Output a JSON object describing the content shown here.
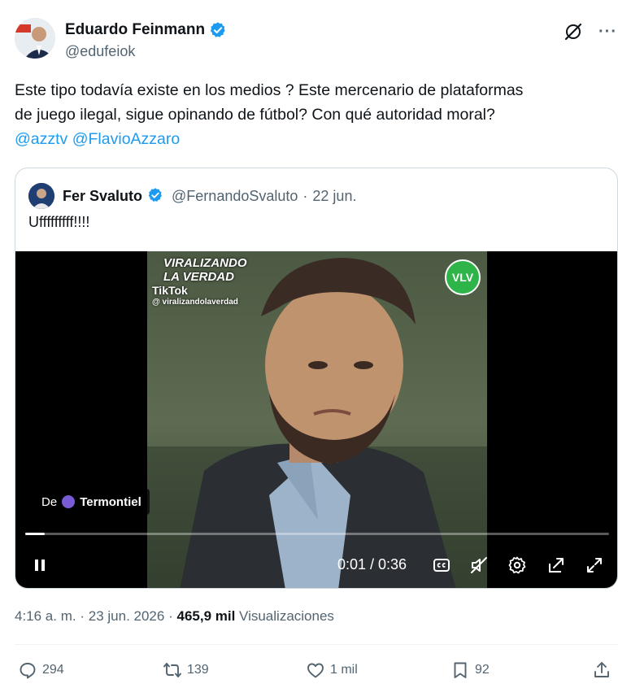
{
  "author": {
    "name": "Eduardo Feinmann",
    "handle": "@edufeiok",
    "verified_color": "#1d9bf0"
  },
  "tweet": {
    "lines": [
      "Este tipo todavía existe en los medios ?  Este mercenario de plataformas",
      "de juego ilegal, sigue opinando de fútbol?  Con qué autoridad moral?"
    ],
    "mentions": "@azztv @FlavioAzzaro"
  },
  "quote": {
    "name": "Fer Svaluto",
    "handle": "@FernandoSvaluto",
    "separator": "·",
    "date": "22 jun.",
    "text": "Ufffffffff!!!!"
  },
  "video": {
    "watermark_brand_line1": "VIRALIZANDO",
    "watermark_brand_line2": "LA VERDAD",
    "watermark_platform": "TikTok",
    "watermark_user": "@ viralizandolaverdad",
    "logo_text": "VLV",
    "source_prefix": "De",
    "source_name": "Termontiel",
    "progress_fraction": 0.034,
    "time": "0:01 / 0:36"
  },
  "meta": {
    "time": "4:16 a. m.",
    "separator": "·",
    "date": "23 jun. 2026",
    "views_count": "465,9 mil",
    "views_label": "Visualizaciones"
  },
  "actions": {
    "replies": "294",
    "reposts": "139",
    "likes": "1 mil",
    "bookmarks": "92"
  },
  "colors": {
    "accent": "#1d9bf0",
    "text": "#0f1419",
    "secondary": "#536471"
  },
  "icons": {
    "verified": "verified-badge-icon",
    "grok": "grok-icon",
    "more": "more-icon",
    "pause": "pause-icon",
    "captions": "captions-icon",
    "mute": "mute-icon",
    "settings": "gear-icon",
    "pop_out": "pop-out-icon",
    "fullscreen": "fullscreen-icon",
    "reply": "reply-icon",
    "repost": "repost-icon",
    "like": "heart-icon",
    "bookmark": "bookmark-icon",
    "share": "share-icon"
  }
}
